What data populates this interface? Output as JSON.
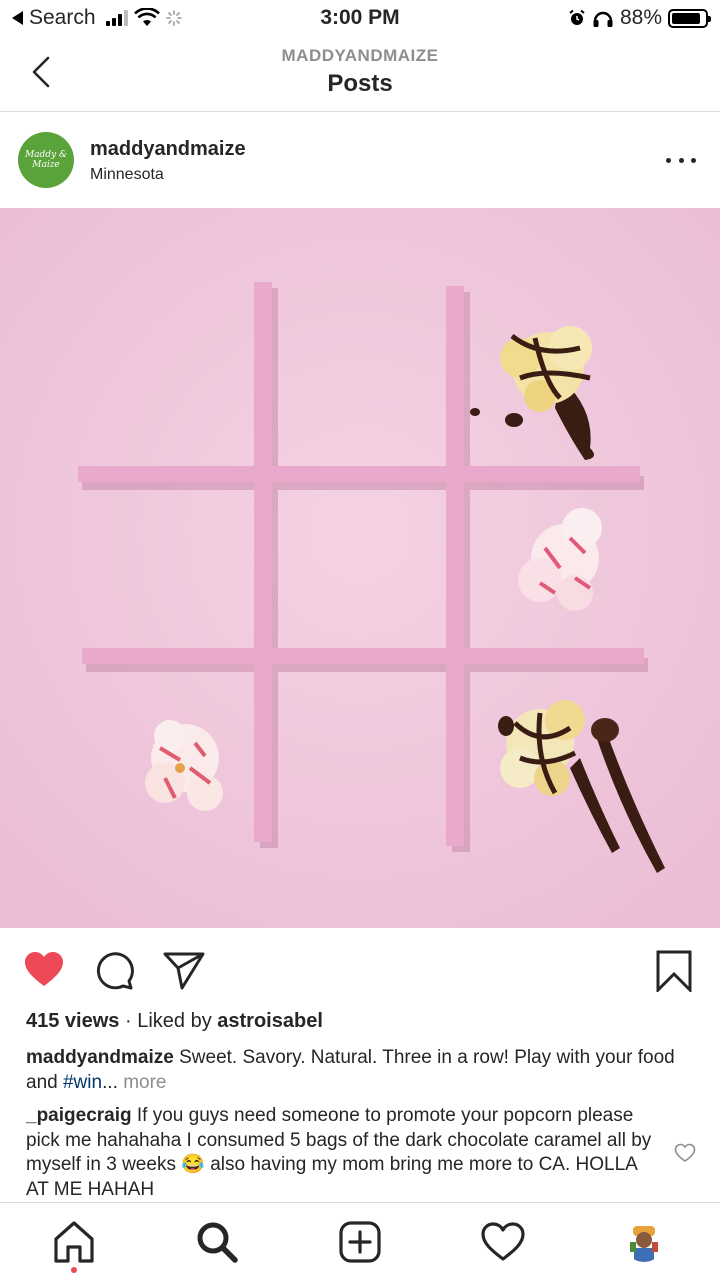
{
  "status_bar": {
    "back_app": "Search",
    "time": "3:00 PM",
    "battery": "88%",
    "battery_level": 0.88
  },
  "nav": {
    "account": "MADDYANDMAIZE",
    "title": "Posts"
  },
  "post": {
    "username": "maddyandmaize",
    "location": "Minnesota",
    "avatar_text": "Maddy & Maize",
    "views_count": "415 views",
    "liked_by_prefix": "· Liked by",
    "liked_by_user": "astroisabel",
    "caption_user": "maddyandmaize",
    "caption_text": "Sweet. Savory. Natural. Three in a row! Play with your food and",
    "caption_tag": "#win",
    "caption_ellipsis": "...",
    "caption_more": "more",
    "liked": true
  },
  "comment": {
    "user": "_paigecraig",
    "text_before": "If you guys need someone to promote your popcorn please pick me hahahaha I consumed 5 bags of the dark chocolate caramel all by myself in 3 weeks",
    "emoji": "😂",
    "text_after": "also having my mom bring me more to CA. HOLLA AT ME HAHAH"
  },
  "icons": {
    "back": "chevron-left-icon",
    "more": "more-dots-icon",
    "like": "heart-filled-icon",
    "comment": "comment-bubble-icon",
    "share": "paper-plane-icon",
    "save": "bookmark-icon",
    "home": "home-icon",
    "search": "search-icon",
    "new_post": "plus-square-icon",
    "activity": "heart-outline-icon",
    "profile": "profile-avatar-icon"
  },
  "colors": {
    "like_red": "#ed4956",
    "hashtag": "#00376b",
    "image_bg": "#f0c7dc",
    "avatar_green": "#5aa33a"
  }
}
